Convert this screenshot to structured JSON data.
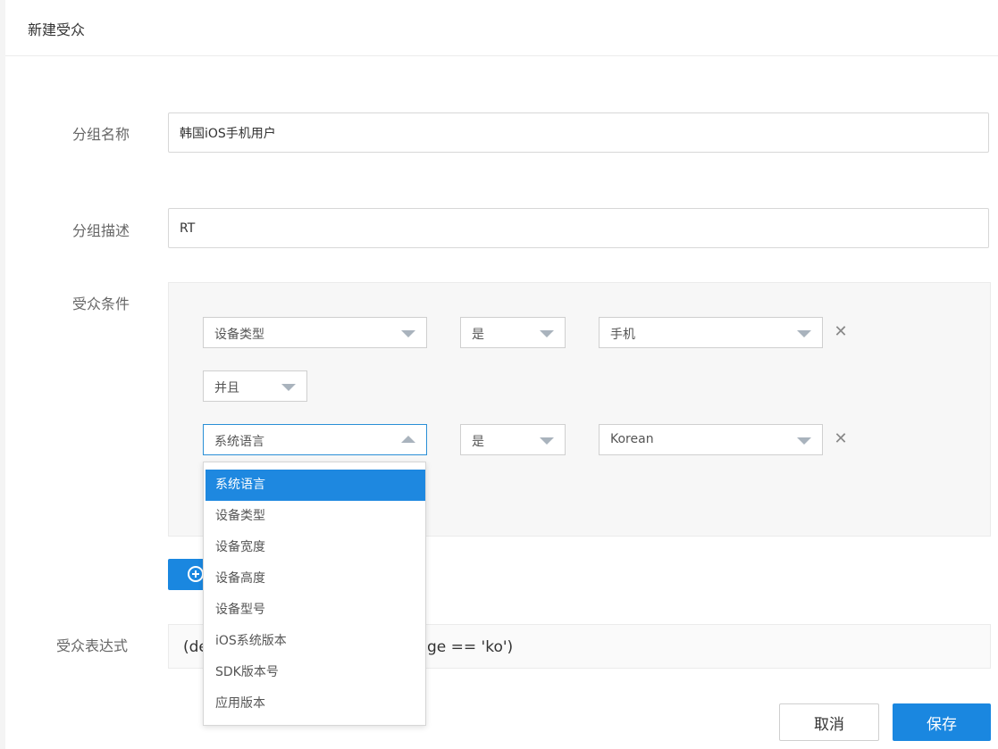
{
  "header": {
    "title": "新建受众"
  },
  "form": {
    "group_name": {
      "label": "分组名称",
      "value": "韩国iOS手机用户"
    },
    "group_desc": {
      "label": "分组描述",
      "value": "RT"
    },
    "conditions_label": "受众条件",
    "expression_label": "受众表达式"
  },
  "conditions": {
    "row1": {
      "field": "设备类型",
      "operator": "是",
      "value": "手机"
    },
    "connector": "并且",
    "row2": {
      "field": "系统语言",
      "operator": "是",
      "value": "Korean"
    },
    "remove_icon": "close-icon"
  },
  "dropdown": {
    "items": [
      "系统语言",
      "设备类型",
      "设备宽度",
      "设备高度",
      "设备型号",
      "iOS系统版本",
      "SDK版本号",
      "应用版本"
    ],
    "selected_index": 0
  },
  "expression": {
    "visible_left": "(de",
    "visible_right": "ge == 'ko')"
  },
  "actions": {
    "cancel": "取消",
    "save": "保存"
  },
  "colors": {
    "primary": "#1a87e0",
    "selected": "#1e88e0",
    "panel": "#f7f7f7"
  }
}
